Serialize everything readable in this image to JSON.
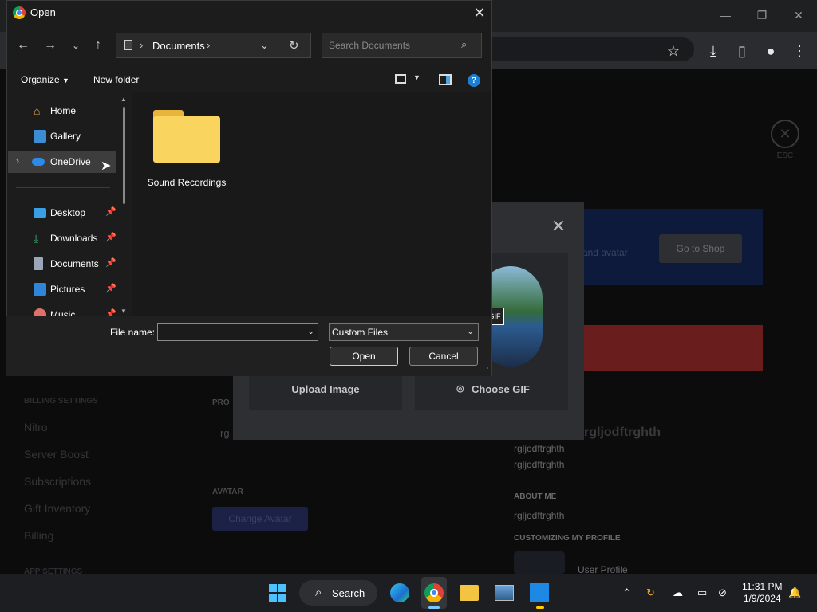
{
  "background": {
    "modal": {
      "upload_label": "Upload Image",
      "gif_label": "Choose GIF",
      "gif_badge": "GIF",
      "close_glyph": "✕"
    },
    "shop_button": "Go to Shop",
    "nitro_hint": "and avatar",
    "esc_glyph": "✕",
    "esc_label": "ESC",
    "sidebar": [
      "BILLING SETTINGS",
      "Nitro",
      "Server Boost",
      "Subscriptions",
      "Gift Inventory",
      "Billing",
      "APP SETTINGS"
    ],
    "preview_name": "rgljodftrghth",
    "preview_name2": "rgljodftrghth",
    "about_me_header": "ABOUT ME",
    "about_me_value": "rgljodftrghth",
    "customizing_header": "CUSTOMIZING MY PROFILE",
    "user_profile": "User Profile",
    "avatar_header": "AVATAR",
    "change_avatar": "Change Avatar",
    "display_name_partial": "rg",
    "profile_partial": "PRO"
  },
  "dialog": {
    "title": "Open",
    "address": {
      "folder": "Documents"
    },
    "search_placeholder": "Search Documents",
    "toolbar": {
      "organize": "Organize",
      "new_folder": "New folder"
    },
    "nav_items": [
      {
        "label": "Home",
        "icon": "home-icon",
        "pinned": false
      },
      {
        "label": "Gallery",
        "icon": "gallery-icon",
        "pinned": false
      },
      {
        "label": "OneDrive",
        "icon": "onedrive-icon",
        "pinned": false,
        "selected": true
      },
      {
        "label": "Desktop",
        "icon": "desktop-icon",
        "pinned": true
      },
      {
        "label": "Downloads",
        "icon": "downloads-icon",
        "pinned": true
      },
      {
        "label": "Documents",
        "icon": "documents-icon",
        "pinned": true
      },
      {
        "label": "Pictures",
        "icon": "pictures-icon",
        "pinned": true
      },
      {
        "label": "Music",
        "icon": "music-icon",
        "pinned": true
      }
    ],
    "items": [
      {
        "name": "Sound Recordings",
        "type": "folder"
      }
    ],
    "file_name_label": "File name:",
    "file_name_value": "",
    "file_type": "Custom Files",
    "open_button": "Open",
    "cancel_button": "Cancel"
  },
  "taskbar": {
    "search_label": "Search",
    "time": "11:31 PM",
    "date": "1/9/2024"
  },
  "colors": {
    "folder": "#f9d45e",
    "accent": "#0067c0",
    "nitro_blue": "#0d1a3c"
  }
}
